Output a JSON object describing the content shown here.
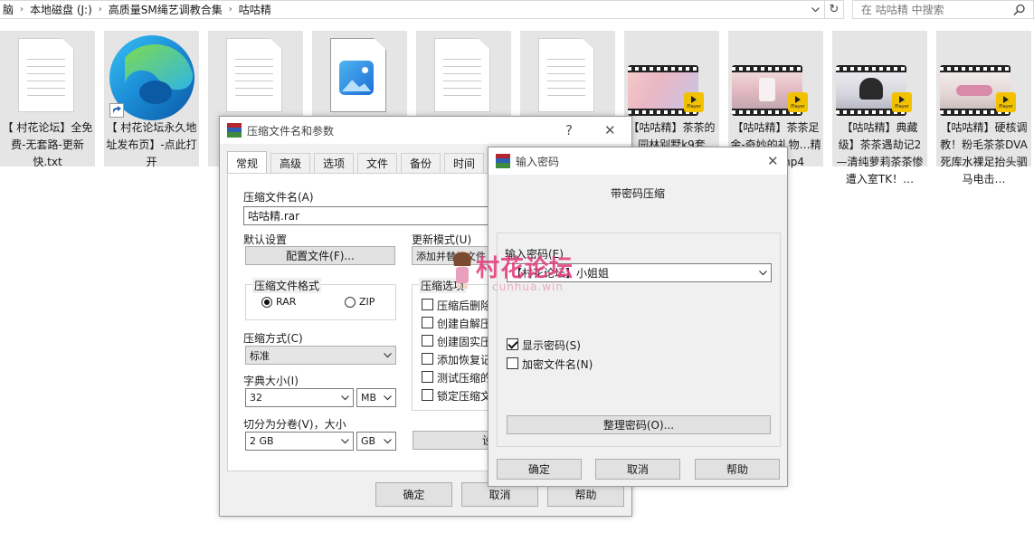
{
  "explorer": {
    "breadcrumbs": [
      "脑",
      "本地磁盘 (J:)",
      "高质量SM绳艺调教合集",
      "咕咕精"
    ],
    "search_placeholder": "在 咕咕精 中搜索",
    "files": [
      {
        "kind": "doc",
        "caption": "【 村花论坛】全免费-无套路-更新快.txt"
      },
      {
        "kind": "edge",
        "caption": "【 村花论坛永久地址发布页】-点此打开"
      },
      {
        "kind": "doc",
        "caption": ""
      },
      {
        "kind": "image",
        "caption": ""
      },
      {
        "kind": "doc",
        "caption": ""
      },
      {
        "kind": "doc",
        "caption": ""
      },
      {
        "kind": "video",
        "caption": "【咕咕精】茶茶的园林别墅k9套"
      },
      {
        "kind": "video",
        "caption": "【咕咕精】茶茶足金-奇妙的礼物…精装着…mp4"
      },
      {
        "kind": "video",
        "caption": "【咕咕精】典藏级】茶茶遇劫记2—清纯萝莉茶茶惨遭入室TK！…"
      },
      {
        "kind": "video",
        "caption": "【咕咕精】硬核调教！粉毛茶茶DVA死库水裸足抬头驷马电击…"
      }
    ],
    "player_badge": "Player"
  },
  "archive_dialog": {
    "title": "压缩文件名和参数",
    "help_glyph": "?",
    "close_glyph": "✕",
    "tabs": [
      "常规",
      "高级",
      "选项",
      "文件",
      "备份",
      "时间"
    ],
    "archive_name_label": "压缩文件名(A)",
    "archive_name_value": "咕咕精.rar",
    "default_settings_label": "默认设置",
    "profiles_button": "配置文件(F)...",
    "update_mode_label": "更新模式(U)",
    "update_mode_value": "添加并替换文件",
    "format_group": "压缩文件格式",
    "format_rar": "RAR",
    "format_zip": "ZIP",
    "method_label": "压缩方式(C)",
    "method_value": "标准",
    "dict_label": "字典大小(I)",
    "dict_value": "32",
    "dict_unit": "MB",
    "split_label": "切分为分卷(V)，大小",
    "split_value": "2 GB",
    "split_unit": "GB",
    "options_group": "压缩选项",
    "options": [
      "压缩后删除",
      "创建自解压",
      "创建固实压",
      "添加恢复记",
      "测试压缩的",
      "锁定压缩文"
    ],
    "set_password_button": "设",
    "ok": "确定",
    "cancel": "取消",
    "help": "帮助"
  },
  "password_dialog": {
    "title": "输入密码",
    "close_glyph": "✕",
    "heading": "带密码压缩",
    "password_label": "输入密码(E)",
    "password_value": "【村花论坛】小姐姐",
    "show_password": "显示密码(S)",
    "encrypt_names": "加密文件名(N)",
    "organize_button": "整理密码(O)...",
    "ok": "确定",
    "cancel": "取消",
    "help": "帮助"
  },
  "watermark": {
    "text": "村花论坛",
    "url": "cunhua.win"
  },
  "colors": {
    "winrar_red": "#b3262e",
    "winrar_blue": "#2d5fb5",
    "winrar_green": "#3d8b3d",
    "watermark_pink": "#e23d7a",
    "player_yellow": "#f2c200"
  }
}
